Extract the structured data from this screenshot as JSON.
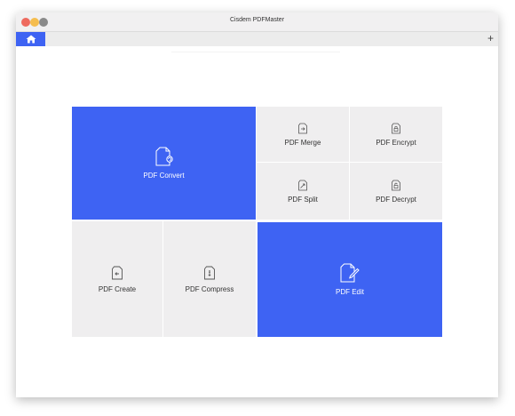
{
  "window": {
    "title": "Cisdem PDFMaster"
  },
  "tabbar": {
    "home_icon": "house-icon",
    "new_tab": "+"
  },
  "colors": {
    "accent": "#3e63f3",
    "tile_gray": "#efeeef"
  },
  "tiles": {
    "pdf_convert": {
      "label": "PDF Convert",
      "icon": "document-convert-icon"
    },
    "pdf_merge": {
      "label": "PDF Merge",
      "icon": "document-merge-icon"
    },
    "pdf_encrypt": {
      "label": "PDF Encrypt",
      "icon": "document-lock-icon"
    },
    "pdf_split": {
      "label": "PDF Split",
      "icon": "document-split-icon"
    },
    "pdf_decrypt": {
      "label": "PDF Decrypt",
      "icon": "document-unlock-icon"
    },
    "pdf_create": {
      "label": "PDF Create",
      "icon": "document-create-icon"
    },
    "pdf_compress": {
      "label": "PDF Compress",
      "icon": "document-compress-icon"
    },
    "pdf_edit": {
      "label": "PDF Edit",
      "icon": "document-edit-icon"
    }
  }
}
